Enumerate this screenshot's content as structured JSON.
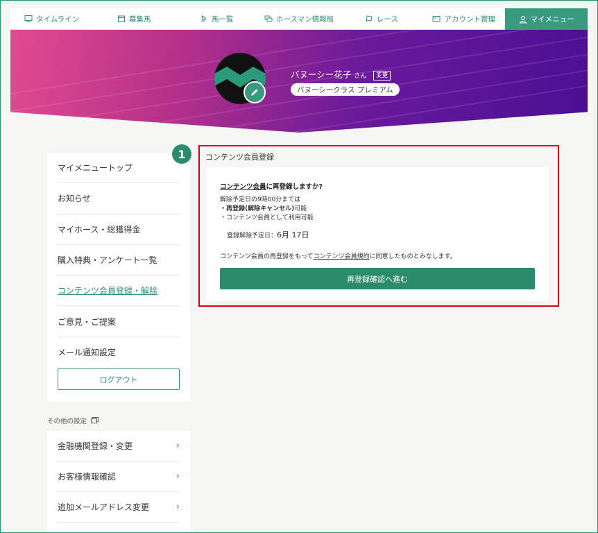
{
  "nav": {
    "items": [
      {
        "label": "タイムライン",
        "icon": "monitor-icon"
      },
      {
        "label": "募集馬",
        "icon": "calendar-icon"
      },
      {
        "label": "馬一覧",
        "icon": "horse-icon"
      },
      {
        "label": "ホースマン情報局",
        "icon": "chat-icon"
      },
      {
        "label": "レース",
        "icon": "flag-icon"
      },
      {
        "label": "アカウント管理",
        "icon": "card-icon"
      },
      {
        "label": "マイメニュー",
        "icon": "user-icon"
      }
    ]
  },
  "profile": {
    "name": "バヌーシー花子",
    "honorific": "さん",
    "change_label": "変更",
    "class_label": "バヌーシークラス プレミアム"
  },
  "sidebar": {
    "items": [
      {
        "label": "マイメニュートップ"
      },
      {
        "label": "お知らせ"
      },
      {
        "label": "マイホース・総獲得金"
      },
      {
        "label": "購入特典・アンケート一覧"
      },
      {
        "label": "コンテンツ会員登録・解除"
      },
      {
        "label": "ご意見・ご提案"
      },
      {
        "label": "メール通知設定"
      }
    ],
    "logout_label": "ログアウト",
    "other_settings_label": "その他の設定",
    "other_items": [
      {
        "label": "金融機関登録・変更"
      },
      {
        "label": "お客様情報確認"
      },
      {
        "label": "追加メールアドレス変更"
      }
    ]
  },
  "main": {
    "step_number": "1",
    "title": "コンテンツ会員登録",
    "question_link": "コンテンツ会員",
    "question_rest": "に再登録しますか?",
    "info_line1": "解除予定日の9時00分までは",
    "info_line2_bold": "・再登録(解除キャンセル)",
    "info_line2_rest": "可能",
    "info_line3": "・コンテンツ会員として利用可能",
    "date_label": "登録解除予定日：",
    "date_value": "6月 17日",
    "agree_prefix": "コンテンツ会員の再登録をもって",
    "agree_link": "コンテンツ会員規約",
    "agree_suffix": "に同意したものとみなします。",
    "proceed_label": "再登録確認へ進む"
  },
  "colors": {
    "accent": "#2a8c6a",
    "highlight": "#e00000"
  }
}
